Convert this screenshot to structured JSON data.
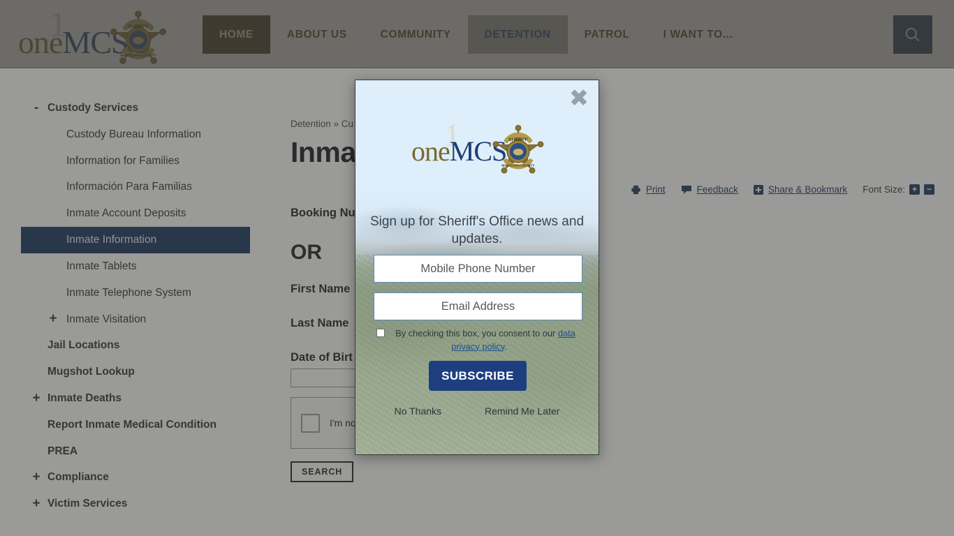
{
  "brand": {
    "logo_one": "1",
    "logo_prefix": "one",
    "logo_suffix": "MCSO",
    "badge_top": "SHERIFF",
    "badge_bottom": "MARICOPA COUNTY"
  },
  "nav": {
    "items": [
      {
        "label": "HOME",
        "state": "active-home"
      },
      {
        "label": "ABOUT US",
        "state": ""
      },
      {
        "label": "COMMUNITY",
        "state": ""
      },
      {
        "label": "DETENTION",
        "state": "active-section"
      },
      {
        "label": "PATROL",
        "state": ""
      },
      {
        "label": "I WANT TO...",
        "state": ""
      }
    ],
    "search_icon": "search-icon"
  },
  "sidebar": {
    "items": [
      {
        "label": "Custody Services",
        "level": "top",
        "toggle": "-",
        "selected": false
      },
      {
        "label": "Custody Bureau Information",
        "level": "child",
        "toggle": "",
        "selected": false
      },
      {
        "label": "Information for Families",
        "level": "child",
        "toggle": "",
        "selected": false
      },
      {
        "label": "Información Para Familias",
        "level": "child",
        "toggle": "",
        "selected": false
      },
      {
        "label": "Inmate Account Deposits",
        "level": "child",
        "toggle": "",
        "selected": false
      },
      {
        "label": "Inmate Information",
        "level": "child",
        "toggle": "",
        "selected": true
      },
      {
        "label": "Inmate Tablets",
        "level": "child",
        "toggle": "",
        "selected": false
      },
      {
        "label": "Inmate Telephone System",
        "level": "child",
        "toggle": "",
        "selected": false
      },
      {
        "label": "Inmate Visitation",
        "level": "child",
        "toggle": "+",
        "selected": false
      },
      {
        "label": "Jail Locations",
        "level": "top",
        "toggle": "",
        "selected": false
      },
      {
        "label": "Mugshot Lookup",
        "level": "top",
        "toggle": "",
        "selected": false
      },
      {
        "label": "Inmate Deaths",
        "level": "top",
        "toggle": "+",
        "selected": false
      },
      {
        "label": "Report Inmate Medical Condition",
        "level": "top",
        "toggle": "",
        "selected": false
      },
      {
        "label": "PREA",
        "level": "top",
        "toggle": "",
        "selected": false
      },
      {
        "label": "Compliance",
        "level": "top",
        "toggle": "+",
        "selected": false
      },
      {
        "label": "Victim Services",
        "level": "top",
        "toggle": "+",
        "selected": false
      }
    ]
  },
  "main": {
    "breadcrumb": "Detention » Cu",
    "title": "Inmat",
    "utilities": {
      "print": "Print",
      "feedback": "Feedback",
      "share": "Share & Bookmark",
      "font_size_label": "Font Size:",
      "font_increase": "+",
      "font_decrease": "−"
    },
    "form": {
      "booking_label": "Booking Nu",
      "or_text": "OR",
      "first_name_label": "First Name",
      "last_name_label": "Last Name",
      "dob_label": "Date of Birt",
      "dob_value": "",
      "recaptcha_text": "I'm no",
      "search_button": "SEARCH"
    }
  },
  "modal": {
    "close_icon": "close-icon",
    "logo_one": "1",
    "logo_prefix": "one",
    "logo_suffix": "MCSO",
    "heading": "Sign up for Sheriff's Office news and updates.",
    "phone_placeholder": "Mobile Phone Number",
    "email_placeholder": "Email Address",
    "consent_prefix": "By checking this box, you consent to our ",
    "consent_link": "data privacy policy",
    "consent_suffix": ".",
    "subscribe_label": "SUBSCRIBE",
    "no_thanks": "No Thanks",
    "remind_later": "Remind Me Later"
  },
  "colors": {
    "nav_home_bg": "#463616",
    "nav_section_bg": "#a9a79f",
    "search_bg": "#1b3661",
    "sidebar_selected_bg": "#14305c",
    "subscribe_bg": "#1d3f80",
    "link_blue": "#1b4f8f",
    "scrim": "rgba(61,61,58,0.52)"
  }
}
